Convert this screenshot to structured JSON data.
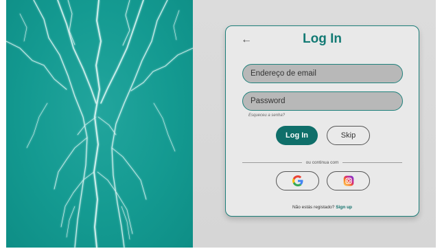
{
  "login": {
    "title": "Log In",
    "email_placeholder": "Endereço de email",
    "password_placeholder": "Password",
    "forgot_link": "Esqueceu a senha?",
    "login_button": "Log In",
    "skip_button": "Skip",
    "divider_text": "ou continua com",
    "signup_prompt": "Não estás registado?",
    "signup_link": "Sign up"
  },
  "icons": {
    "back": "arrow-left-icon",
    "google": "google-icon",
    "instagram": "instagram-icon"
  },
  "colors": {
    "accent": "#137a74",
    "hero_bg": "#149a91",
    "field_bg": "#b8b8b8",
    "card_bg": "#e9e9e9"
  }
}
